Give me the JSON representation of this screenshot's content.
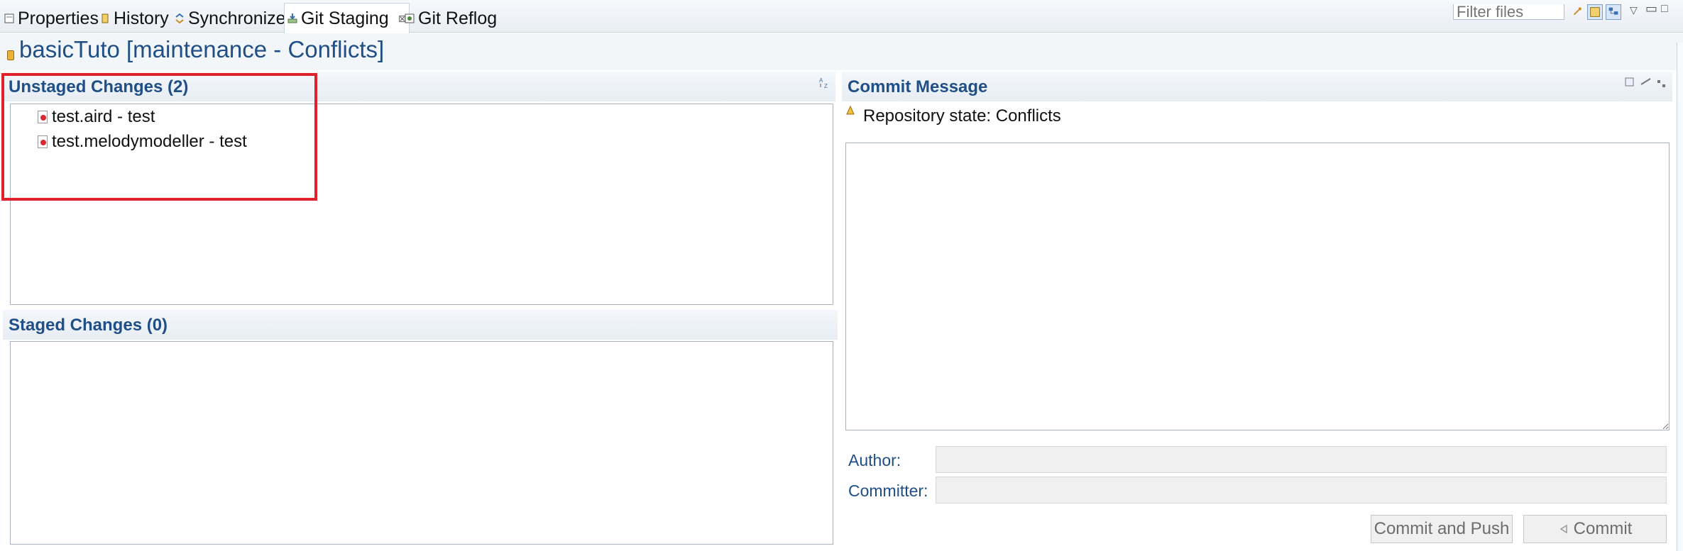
{
  "tabs": [
    {
      "label": "Properties",
      "icon": "properties-icon"
    },
    {
      "label": "History",
      "icon": "history-icon"
    },
    {
      "label": "Synchronize",
      "icon": "synchronize-icon"
    },
    {
      "label": "Git Staging",
      "icon": "git-staging-icon",
      "active": true
    },
    {
      "label": "Git Reflog",
      "icon": "git-reflog-icon"
    }
  ],
  "filter": {
    "placeholder": "Filter files"
  },
  "title": "basicTuto [maintenance - Conflicts]",
  "unstaged": {
    "header": "Unstaged Changes (2)",
    "files": [
      {
        "label": "test.aird - test",
        "icon": "conflict-file-icon"
      },
      {
        "label": "test.melodymodeller - test",
        "icon": "conflict-file-icon"
      }
    ]
  },
  "staged": {
    "header": "Staged Changes (0)"
  },
  "commit": {
    "header": "Commit Message",
    "repo_state": "Repository state: Conflicts",
    "author_label": "Author:",
    "committer_label": "Committer:",
    "commit_and_push_label": "Commit and Push",
    "commit_label": "Commit"
  },
  "colors": {
    "header_text": "#1f4f86",
    "highlight_border": "#e0202a",
    "conflict_marker": "#d9282f"
  }
}
